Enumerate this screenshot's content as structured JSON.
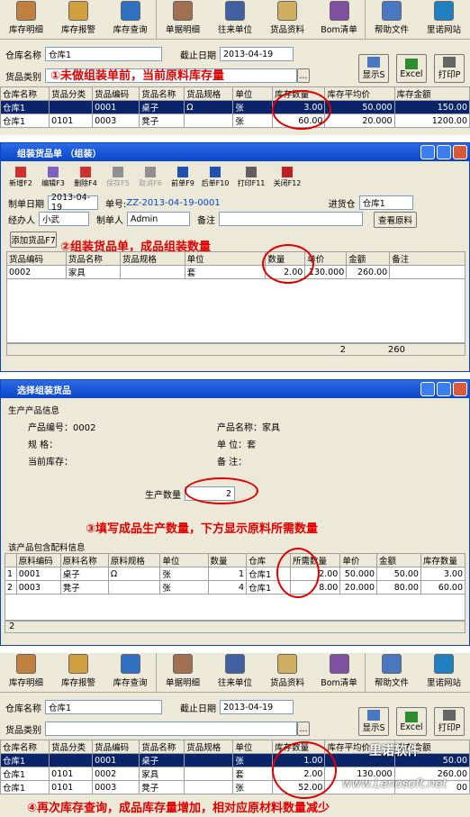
{
  "toolbar": {
    "items": [
      "库存明细",
      "库存报警",
      "库存查询",
      "单据明细",
      "往来单位",
      "货品资料",
      "Bom清单",
      "帮助文件",
      "里诺网站"
    ]
  },
  "filter": {
    "warehouse_label": "仓库名称",
    "warehouse_value": "仓库1",
    "date_label": "截止日期",
    "date_value": "2013-04-19",
    "category_label": "货品类别",
    "category_button": "...",
    "show_button": "显示S",
    "excel_button": "Excel",
    "print_button": "打印P"
  },
  "stock_columns": [
    "仓库名称",
    "货品分类",
    "货品编码",
    "货品名称",
    "货品规格",
    "单位",
    "库存数量",
    "库存平均价",
    "库存金额"
  ],
  "stock_before": [
    [
      "仓库1",
      "",
      "0001",
      "桌子",
      "Ω",
      "张",
      "3.00",
      "50.000",
      "150.00"
    ],
    [
      "仓库1",
      "0101",
      "0003",
      "凳子",
      "",
      "张",
      "60.00",
      "20.000",
      "1200.00"
    ]
  ],
  "stock_after": [
    [
      "仓库1",
      "",
      "0001",
      "桌子",
      "",
      "张",
      "1.00",
      "",
      "50.00"
    ],
    [
      "仓库1",
      "0101",
      "0002",
      "家具",
      "",
      "套",
      "2.00",
      "130.000",
      "260.00"
    ],
    [
      "仓库1",
      "0101",
      "0003",
      "凳子",
      "",
      "张",
      "52.00",
      "",
      "00"
    ]
  ],
  "annotations": {
    "step1": "①未做组装单前，当前原料库存量",
    "step2": "②组装货品单，成品组装数量",
    "step3": "③填写成品生产数量，下方显示原料所需数量",
    "step4": "④再次库存查询，成品库存量增加，相对应原材料数量减少"
  },
  "assembly": {
    "title": "组装货品单   （组装）",
    "tools": [
      "新增F2",
      "编辑F3",
      "删除F4",
      "保存F5",
      "取消F6",
      "前单F9",
      "后单F10",
      "打印F11",
      "关闭F12"
    ],
    "date_label": "制单日期",
    "date_value": "2013-04-19",
    "no_label": "单号:",
    "no_value": "ZZ-2013-04-19-0001",
    "warehouse_label": "进货仓",
    "warehouse_value": "仓库1",
    "manager_label": "经办人",
    "manager_value": "小武",
    "maker_label": "制单人",
    "maker_value": "Admin",
    "remark_label": "备注",
    "view_button": "查看原料",
    "add_button": "添加货品F7",
    "columns": [
      "货品编码",
      "货品名称",
      "货品规格",
      "单位",
      "数量",
      "单价",
      "金额",
      "备注"
    ],
    "row": [
      "0002",
      "家具",
      "",
      "套",
      "2.00",
      "130.000",
      "260.00",
      ""
    ],
    "footer_qty": "2",
    "footer_amount": "260"
  },
  "select": {
    "title": "选择组装货品",
    "group1": "生产产品信息",
    "code_label": "产品编号：0002",
    "name_label": "产品名称：家具",
    "spec_label": "规    格：",
    "unit_label": "单    位：套",
    "stock_label": "当前库存：",
    "remark_label": "备    注：",
    "qty_label": "生产数量",
    "qty_value": "2",
    "group2": "该产品包含配料信息",
    "columns": [
      "",
      "原料编码",
      "原料名称",
      "原料规格",
      "单位",
      "数量",
      "仓库",
      "所需数量",
      "单价",
      "金额",
      "库存数量"
    ],
    "rows": [
      [
        "1",
        "0001",
        "桌子",
        "Ω",
        "张",
        "1",
        "仓库1",
        "2.00",
        "50.000",
        "50.00",
        "3.00"
      ],
      [
        "2",
        "0003",
        "凳子",
        "",
        "张",
        "4",
        "仓库1",
        "8.00",
        "20.000",
        "80.00",
        "60.00"
      ]
    ],
    "footer": "2"
  },
  "watermark": {
    "brand": "里诺软件",
    "site": "www.Lenosoft.net"
  }
}
